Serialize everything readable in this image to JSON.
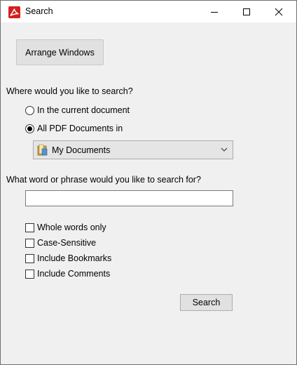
{
  "window": {
    "title": "Search",
    "app_icon": "acrobat-icon",
    "controls": [
      "minimize-icon",
      "maximize-icon",
      "close-icon"
    ]
  },
  "arrange_button": "Arrange Windows",
  "search_location": {
    "question": "Where would you like to search?",
    "options": [
      {
        "label": "In the current document",
        "selected": false
      },
      {
        "label": "All PDF Documents in",
        "selected": true
      }
    ],
    "folder": {
      "value": "My Documents",
      "icon": "folder-icon"
    }
  },
  "search_term": {
    "question": "What word or phrase would you like to search for?",
    "value": ""
  },
  "options": [
    {
      "label": "Whole words only",
      "checked": false
    },
    {
      "label": "Case-Sensitive",
      "checked": false
    },
    {
      "label": "Include Bookmarks",
      "checked": false
    },
    {
      "label": "Include Comments",
      "checked": false
    }
  ],
  "search_button": "Search"
}
